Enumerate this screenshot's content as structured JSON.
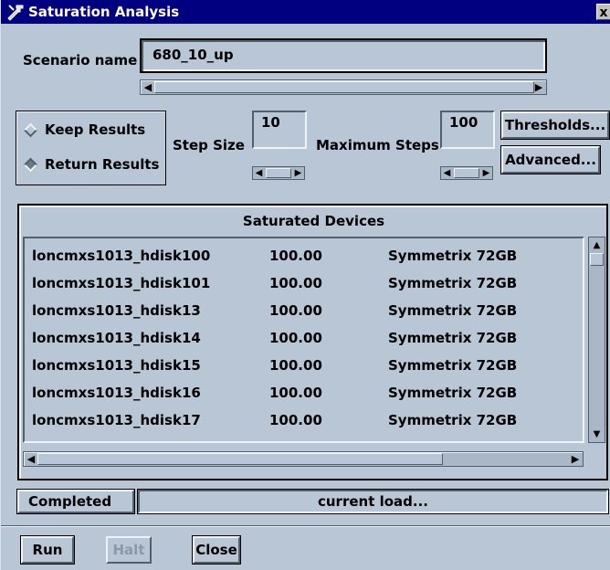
{
  "window": {
    "title": "Saturation Analysis",
    "close_glyph": "x",
    "icon": "tools-icon"
  },
  "scenario": {
    "label": "Scenario name",
    "value": "680_10_up"
  },
  "options": {
    "keep_results": "Keep Results",
    "return_results": "Return Results",
    "selected": "return_results",
    "step_size_label": "Step Size",
    "step_size_value": "10",
    "max_steps_label": "Maximum Steps",
    "max_steps_value": "100",
    "thresholds_button": "Thresholds...",
    "advanced_button": "Advanced..."
  },
  "devices": {
    "header": "Saturated Devices",
    "rows": [
      {
        "name": "loncmxs1013_hdisk100",
        "value": "100.00",
        "type": "Symmetrix 72GB"
      },
      {
        "name": "loncmxs1013_hdisk101",
        "value": "100.00",
        "type": "Symmetrix 72GB"
      },
      {
        "name": "loncmxs1013_hdisk13",
        "value": "100.00",
        "type": "Symmetrix 72GB"
      },
      {
        "name": "loncmxs1013_hdisk14",
        "value": "100.00",
        "type": "Symmetrix 72GB"
      },
      {
        "name": "loncmxs1013_hdisk15",
        "value": "100.00",
        "type": "Symmetrix 72GB"
      },
      {
        "name": "loncmxs1013_hdisk16",
        "value": "100.00",
        "type": "Symmetrix 72GB"
      },
      {
        "name": "loncmxs1013_hdisk17",
        "value": "100.00",
        "type": "Symmetrix 72GB"
      }
    ]
  },
  "status": {
    "state": "Completed",
    "message": "current load..."
  },
  "actions": {
    "run": "Run",
    "halt": "Halt",
    "close": "Close"
  },
  "colors": {
    "panel": "#b9c6d6",
    "titlebar": "#000080"
  }
}
